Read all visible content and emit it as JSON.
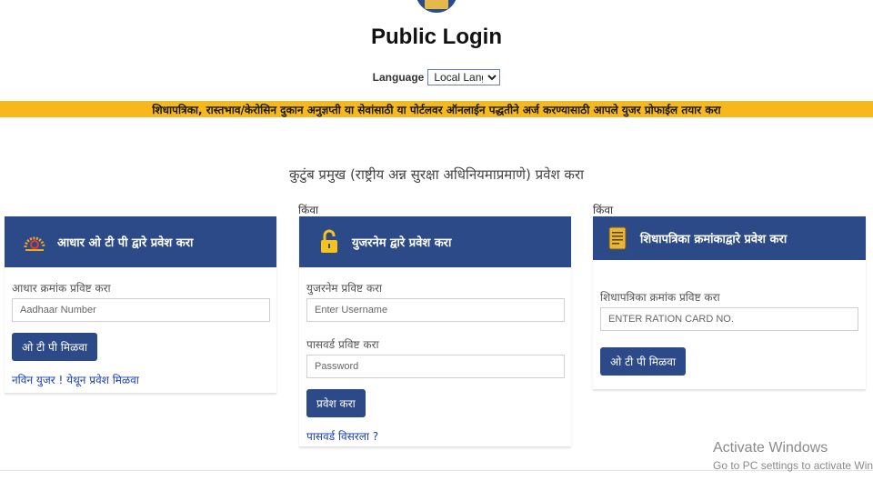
{
  "page": {
    "title": "Public Login",
    "language_label": "Language",
    "language_selected": "Local Langu",
    "banner_text": "शिधापत्रिका, रास्तभाव/केरोसिन दुकान अनुज्ञप्ती या सेवांसाठी या पोर्टलवर ऑनलाईन पद्धतीने अर्ज करण्यासाठी आपले युजर प्रोफाईल तयार करा",
    "section_heading": "कुटुंब प्रमुख (राष्ट्रीय अन्न सुरक्षा अधिनियमाप्रमाणे) प्रवेश करा",
    "or_label": "किंवा"
  },
  "cards": {
    "aadhaar": {
      "header": "आधार ओ टी पी द्वारे प्रवेश करा",
      "field_label": "आधार क्रमांक प्रविष्ट करा",
      "placeholder": "Aadhaar Number",
      "button": "ओ टी पी मिळवा",
      "link": "नविन युजर ! येथून प्रवेश मिळवा"
    },
    "username": {
      "header": "युजरनेम द्वारे प्रवेश करा",
      "username_label": "युजरनेम प्रविष्ट करा",
      "username_placeholder": "Enter Username",
      "password_label": "पासवर्ड प्रविष्ट करा",
      "password_placeholder": "Password",
      "button": "प्रवेश करा",
      "link": "पासवर्ड विसरला ?"
    },
    "ration": {
      "header": "शिधापत्रिका क्रमांकाद्वारे प्रवेश करा",
      "field_label": "शिधापत्रिका क्रमांक प्रविष्ट करा",
      "placeholder": "ENTER RATION CARD NO.",
      "button": "ओ टी पी मिळवा"
    }
  },
  "watermark": {
    "line1": "Activate Windows",
    "line2": "Go to PC settings to activate Windows."
  },
  "colors": {
    "banner": "#f6b81a",
    "card_header": "#2d4a88",
    "button": "#2d4a88",
    "link": "#1a3fb3"
  },
  "icons": {
    "aadhaar": "aadhaar-logo-icon",
    "username": "padlock-icon",
    "ration": "ration-card-icon"
  }
}
